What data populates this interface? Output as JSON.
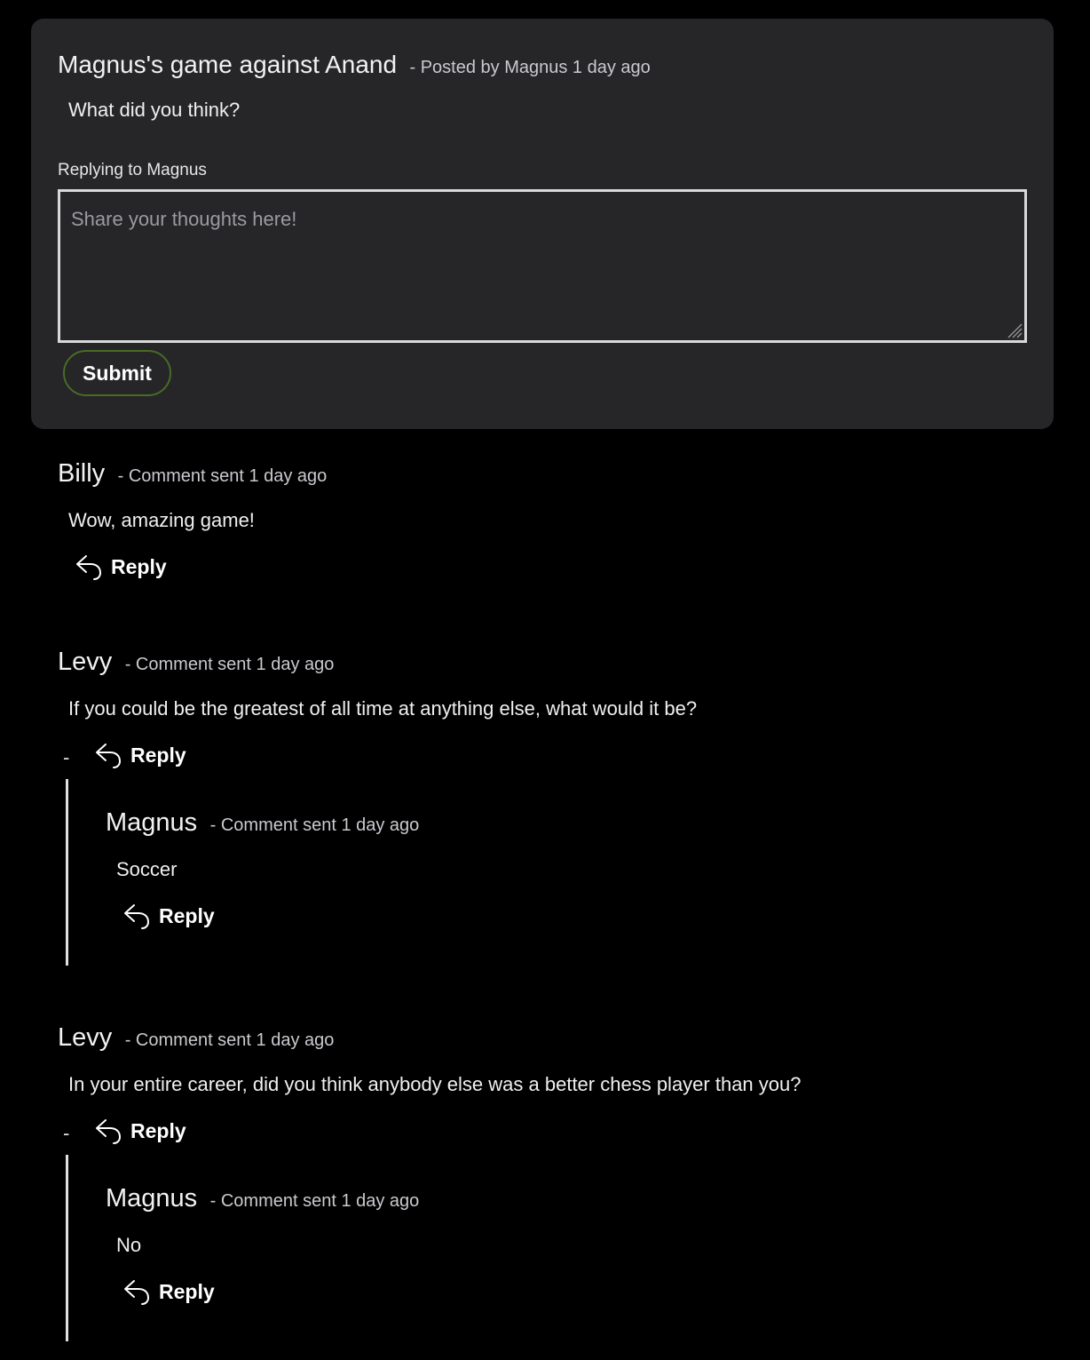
{
  "post": {
    "title": "Magnus's game against Anand",
    "meta": "- Posted by Magnus 1 day ago",
    "body": "What did you think?",
    "replying_to": "Replying to Magnus",
    "placeholder": "Share your thoughts here!",
    "submit_label": "Submit"
  },
  "comments": [
    {
      "author": "Billy",
      "meta": "- Comment sent 1 day ago",
      "body": "Wow, amazing game!",
      "reply_label": "Reply"
    },
    {
      "author": "Levy",
      "meta": "- Comment sent 1 day ago",
      "body": "If you could be the greatest of all time at anything else, what would it be?",
      "reply_label": "Reply",
      "collapse": "-",
      "replies": [
        {
          "author": "Magnus",
          "meta": "- Comment sent 1 day ago",
          "body": "Soccer",
          "reply_label": "Reply"
        }
      ]
    },
    {
      "author": "Levy",
      "meta": "- Comment sent 1 day ago",
      "body": "In your entire career, did you think anybody else was a better chess player than you?",
      "reply_label": "Reply",
      "collapse": "-",
      "replies": [
        {
          "author": "Magnus",
          "meta": "- Comment sent 1 day ago",
          "body": "No",
          "reply_label": "Reply"
        }
      ]
    }
  ],
  "icons": {
    "reply": "reply-arrow-icon",
    "resize": "resize-grip-icon"
  },
  "colors": {
    "background": "#000000",
    "card": "#262628",
    "submit_border": "#4a6a25",
    "meta_text": "#c9c9cf"
  }
}
